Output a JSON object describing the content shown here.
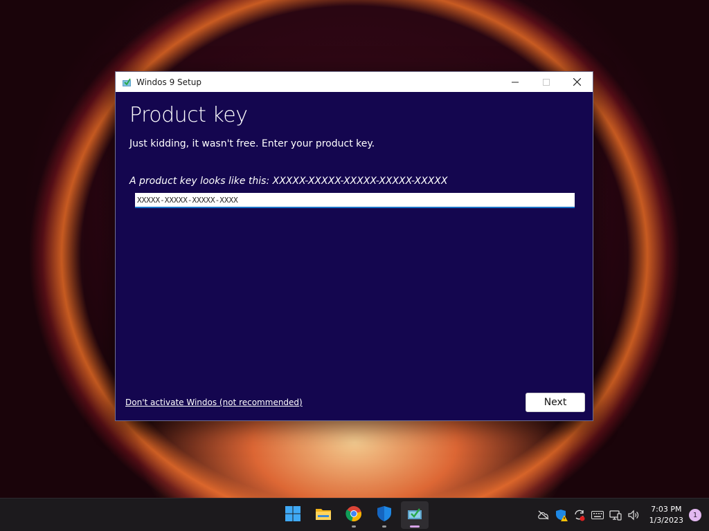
{
  "window": {
    "title": "Windos 9 Setup",
    "heading": "Product key",
    "subtext": "Just kidding, it wasn't free. Enter your product key.",
    "hint": "A product key looks like this: XXXXX-XXXXX-XXXXX-XXXXX-XXXXX",
    "input_value": "XXXXX-XXXXX-XXXXX-XXXX",
    "skip_link": "Don't activate Windos (not recommended)",
    "next_label": "Next"
  },
  "taskbar": {
    "apps": [
      "start-icon",
      "file-explorer-icon",
      "chrome-icon",
      "defender-icon",
      "setup-icon"
    ],
    "clock_time": "7:03 PM",
    "clock_date": "1/3/2023",
    "notification_count": "1"
  },
  "colors": {
    "window_bg": "#14064f",
    "accent": "#1a73c8",
    "notif_badge": "#e2b8f0"
  }
}
